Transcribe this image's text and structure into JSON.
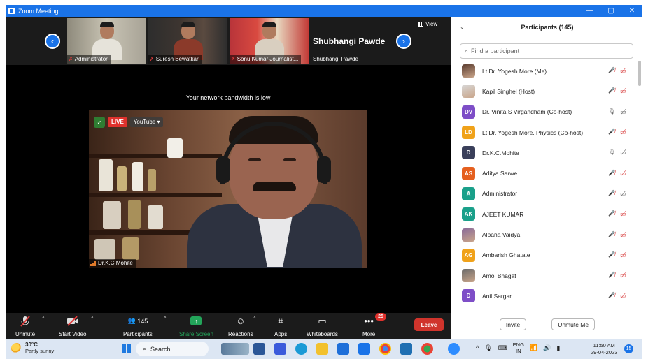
{
  "window": {
    "title": "Zoom Meeting",
    "controls": [
      "—",
      "▢",
      "✕"
    ]
  },
  "strip": {
    "prev_icon": "chevron-left-icon",
    "next_icon": "chevron-right-icon",
    "view_label": "View",
    "thumbnails": [
      {
        "name": "Administrator",
        "muted": true
      },
      {
        "name": "Suresh Bewatkar",
        "muted": true
      },
      {
        "name": "Sonu Kumar Journalist...",
        "muted": true
      }
    ],
    "name_tile": {
      "big": "Shubhangi Pawde",
      "small": "Shubhangi Pawde"
    }
  },
  "main": {
    "bandwidth_notice": "Your network bandwidth is low",
    "live_label": "LIVE",
    "youtube_label": "YouTube ▾",
    "speaker_name": "Dr.K.C.Mohite"
  },
  "toolbar": {
    "unmute": "Unmute",
    "start_video": "Start Video",
    "participants": "Participants",
    "participants_count": "145",
    "share_screen": "Share Screen",
    "reactions": "Reactions",
    "apps": "Apps",
    "whiteboards": "Whiteboards",
    "more": "More",
    "more_badge": "25",
    "leave": "Leave",
    "share_color": "#23a55a",
    "leave_color": "#d0342c"
  },
  "panel": {
    "title": "Participants (145)",
    "search_placeholder": "Find a participant",
    "invite": "Invite",
    "mute_me": "Unmute Me",
    "participants": [
      {
        "name": "Lt Dr. Yogesh More (Me)",
        "initials": "",
        "color": "#5a3b2e",
        "photo": true,
        "mic": "muted",
        "video": "off"
      },
      {
        "name": "Kapil Singhel (Host)",
        "initials": "",
        "color": "#d8d8d8",
        "photo": true,
        "mic": "muted",
        "video": "off"
      },
      {
        "name": "Dr. Vinita  S Virgandham (Co-host)",
        "initials": "DV",
        "color": "#7e4ec7",
        "photo": false,
        "mic": "on",
        "video": "off-gray"
      },
      {
        "name": "Lt Dr. Yogesh More, Physics (Co-host)",
        "initials": "LD",
        "color": "#f0a21a",
        "photo": false,
        "mic": "muted",
        "video": "off"
      },
      {
        "name": "Dr.K.C.Mohite",
        "initials": "D",
        "color": "#3a3f5a",
        "photo": false,
        "mic": "on-gray",
        "video": "off-gray"
      },
      {
        "name": "Aditya Sarwe",
        "initials": "AS",
        "color": "#e5601f",
        "photo": false,
        "mic": "muted",
        "video": "off"
      },
      {
        "name": "Administrator",
        "initials": "A",
        "color": "#1aa08a",
        "photo": false,
        "mic": "muted",
        "video": "off-gray"
      },
      {
        "name": "AJEET KUMAR",
        "initials": "AK",
        "color": "#1aa08a",
        "photo": false,
        "mic": "muted",
        "video": "off"
      },
      {
        "name": "Alpana Vaidya",
        "initials": "",
        "color": "#8a6a9a",
        "photo": true,
        "mic": "muted",
        "video": "off"
      },
      {
        "name": "Ambarish Ghatate",
        "initials": "AG",
        "color": "#f0a21a",
        "photo": false,
        "mic": "muted",
        "video": "off"
      },
      {
        "name": "Amol Bhagat",
        "initials": "",
        "color": "#6a6a6a",
        "photo": true,
        "mic": "muted",
        "video": "off"
      },
      {
        "name": "Anil Sargar",
        "initials": "D",
        "color": "#7e4ec7",
        "photo": false,
        "mic": "muted",
        "video": "off"
      }
    ]
  },
  "taskbar": {
    "temp": "30°C",
    "weather": "Partly sunny",
    "search": "Search",
    "lang_top": "ENG",
    "lang_bottom": "IN",
    "time": "11:50 AM",
    "date": "29-04-2023",
    "notif": "15"
  }
}
